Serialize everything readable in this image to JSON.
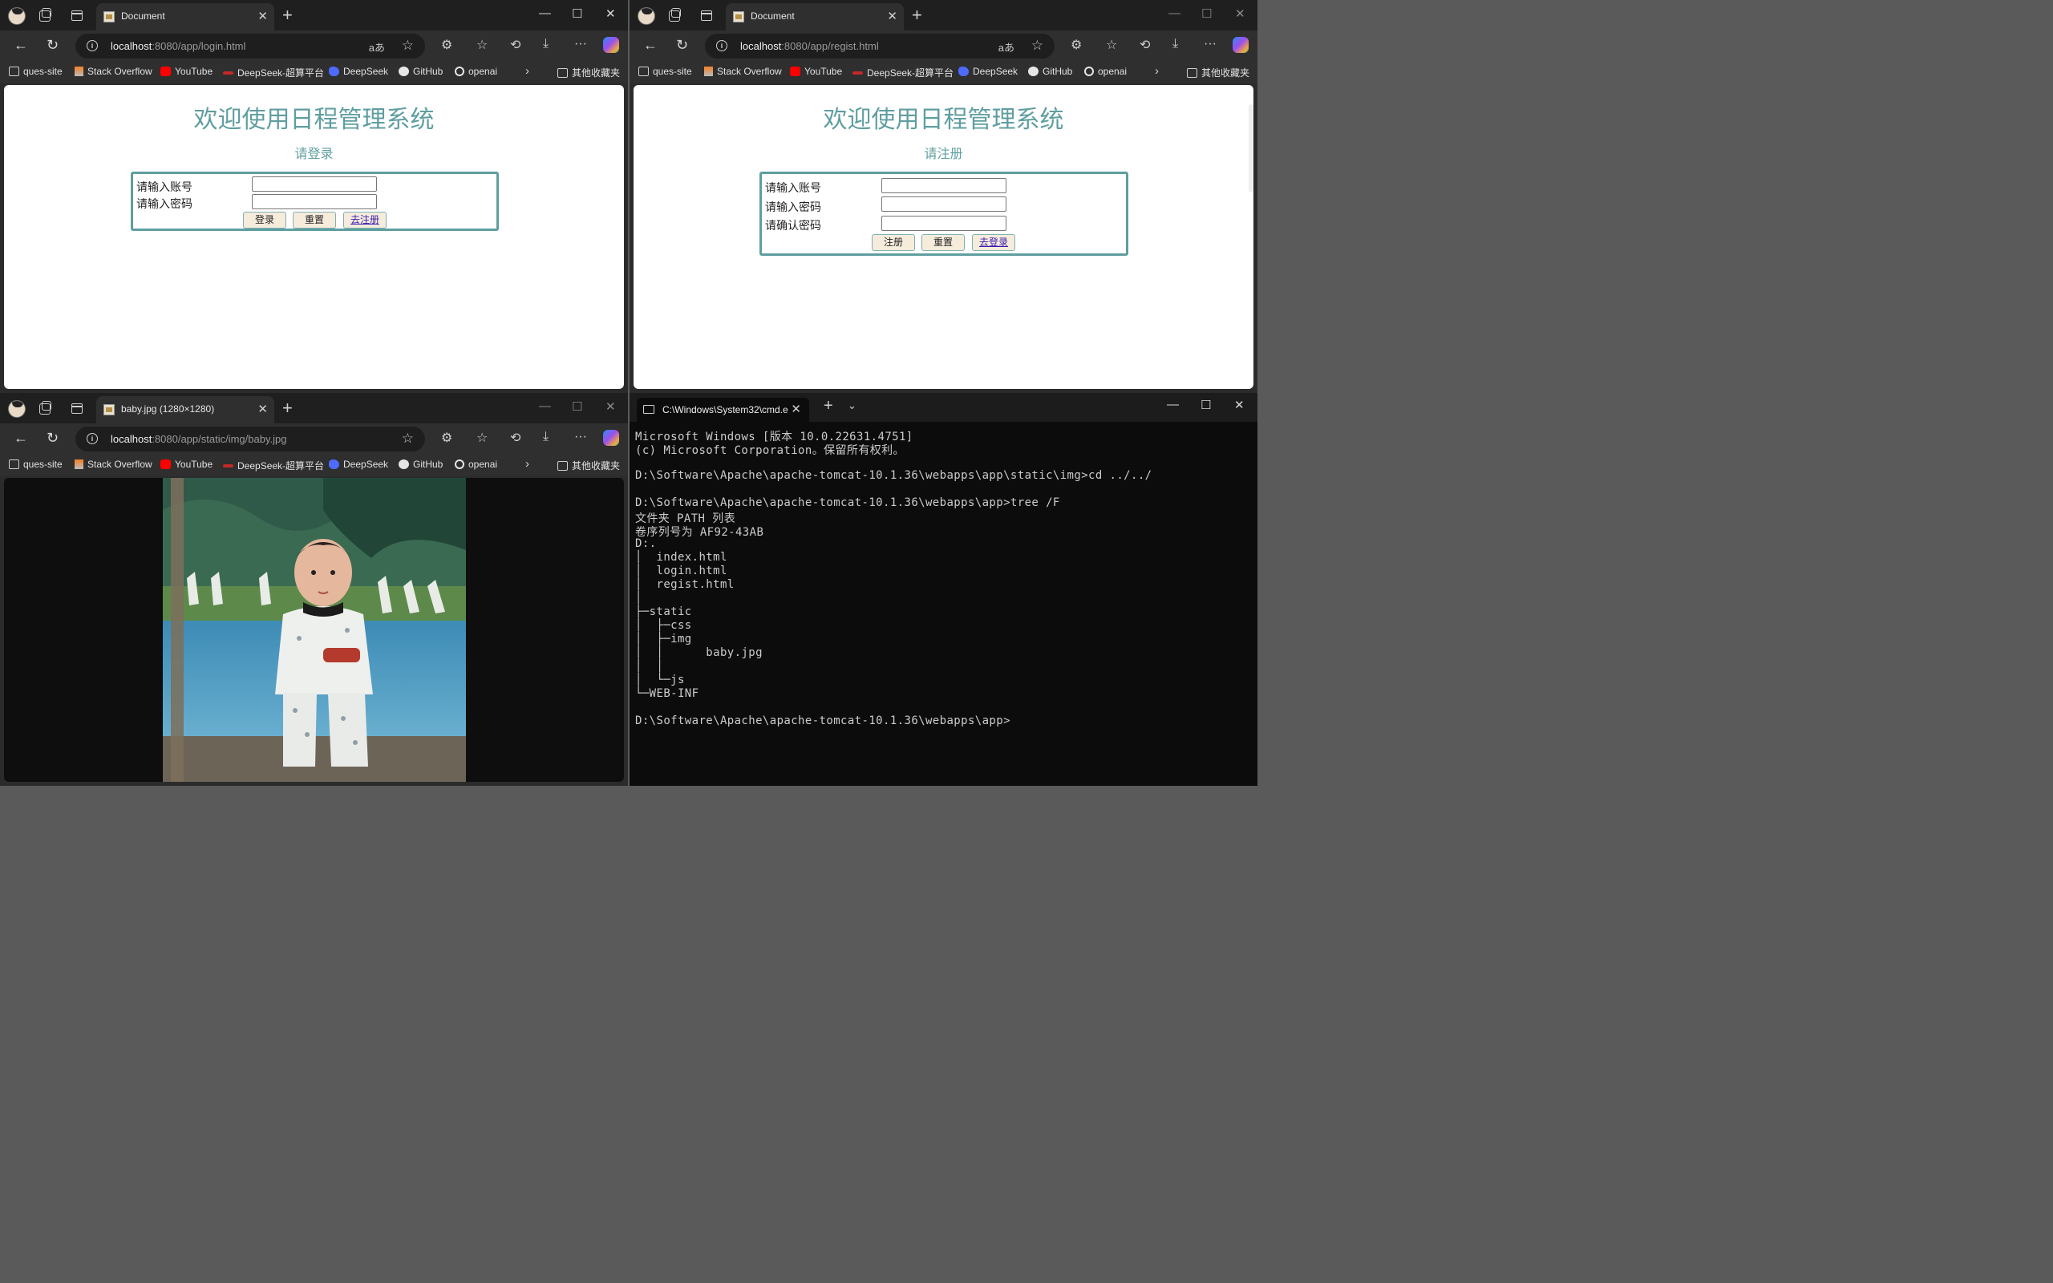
{
  "browser_common": {
    "bookmarks": [
      "ques-site",
      "Stack Overflow",
      "YouTube",
      "DeepSeek-超算平台",
      "DeepSeek",
      "GitHub",
      "openai"
    ],
    "other_bookmarks": "其他收藏夹",
    "reader_icon": "aあ"
  },
  "login_window": {
    "tab_title": "Document",
    "url_host": "localhost",
    "url_rest": ":8080/app/login.html",
    "heading": "欢迎使用日程管理系统",
    "subheading": "请登录",
    "account_label": "请输入账号",
    "password_label": "请输入密码",
    "login_button": "登录",
    "reset_button": "重置",
    "register_link": "去注册"
  },
  "register_window": {
    "tab_title": "Document",
    "url_host": "localhost",
    "url_rest": ":8080/app/regist.html",
    "heading": "欢迎使用日程管理系统",
    "subheading": "请注册",
    "account_label": "请输入账号",
    "password_label": "请输入密码",
    "confirm_label": "请确认密码",
    "register_button": "注册",
    "reset_button": "重置",
    "login_link": "去登录"
  },
  "image_window": {
    "tab_title": "baby.jpg (1280×1280)",
    "url_host": "localhost",
    "url_rest": ":8080/app/static/img/baby.jpg"
  },
  "terminal": {
    "tab_title": "C:\\Windows\\System32\\cmd.e",
    "lines": [
      "Microsoft Windows [版本 10.0.22631.4751]",
      "(c) Microsoft Corporation。保留所有权利。",
      "",
      "D:\\Software\\Apache\\apache-tomcat-10.1.36\\webapps\\app\\static\\img>cd ../../",
      "",
      "D:\\Software\\Apache\\apache-tomcat-10.1.36\\webapps\\app>tree /F",
      "文件夹 PATH 列表",
      "卷序列号为 AF92-43AB",
      "D:.",
      "│  index.html",
      "│  login.html",
      "│  regist.html",
      "│",
      "├─static",
      "│  ├─css",
      "│  ├─img",
      "│  │      baby.jpg",
      "│  │",
      "│  └─js",
      "└─WEB-INF",
      "",
      "D:\\Software\\Apache\\apache-tomcat-10.1.36\\webapps\\app>"
    ]
  },
  "colors": {
    "heading": "#5f9ea0",
    "form_border": "#5f9ea0",
    "button_bg": "#f5ecdc",
    "browser_chrome": "#2f2f2f",
    "terminal_bg": "#0c0c0c"
  }
}
